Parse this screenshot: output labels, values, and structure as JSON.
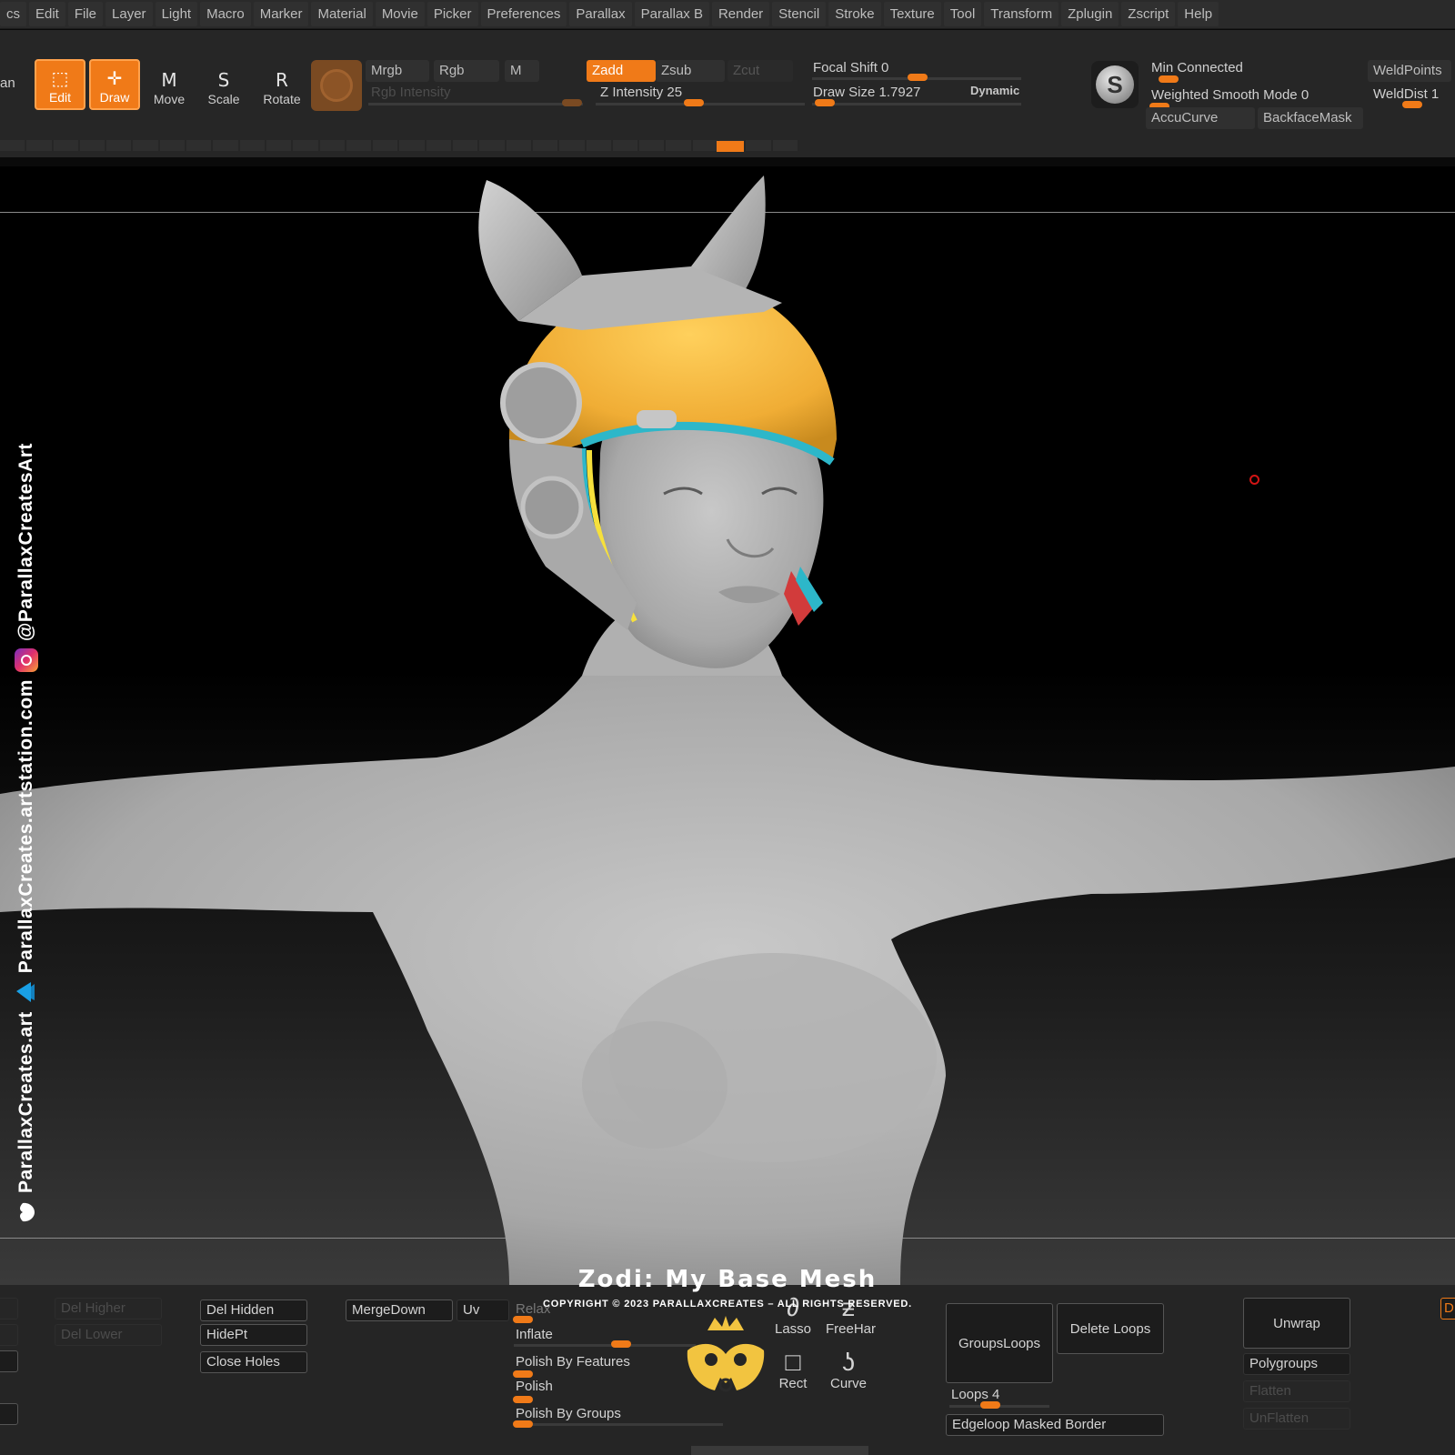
{
  "menu": [
    "cs",
    "Edit",
    "File",
    "Layer",
    "Light",
    "Macro",
    "Marker",
    "Material",
    "Movie",
    "Picker",
    "Preferences",
    "Parallax",
    "Parallax B",
    "Render",
    "Stencil",
    "Stroke",
    "Texture",
    "Tool",
    "Transform",
    "Zplugin",
    "Zscript",
    "Help"
  ],
  "shelf": {
    "left_cut": "an",
    "tools": {
      "edit": "Edit",
      "draw": "Draw",
      "move": "Move",
      "scale": "Scale",
      "rotate": "Rotate"
    },
    "tool_glyphs": {
      "move": "M",
      "scale": "S",
      "rotate": "R"
    },
    "mrgb": "Mrgb",
    "rgb": "Rgb",
    "m": "M",
    "rgb_intensity": "Rgb Intensity",
    "zadd": "Zadd",
    "zsub": "Zsub",
    "zcut": "Zcut",
    "z_intensity": "Z Intensity 25",
    "focal_shift": "Focal Shift 0",
    "draw_size": "Draw Size 1.7927",
    "dynamic": "Dynamic",
    "min_connected": "Min Connected",
    "weighted_smooth": "Weighted Smooth Mode 0",
    "accucurve": "AccuCurve",
    "backfacemask": "BackfaceMask",
    "weldpoints": "WeldPoints",
    "welddist": "WeldDist 1",
    "zremesher_glyph": "S"
  },
  "overlay": {
    "watermark_site": "ParallaxCreates.art",
    "watermark_artstation": "ParallaxCreates.artstation.com",
    "watermark_instagram": "@ParallaxCreatesArt",
    "title": "Zodi: My Base Mesh",
    "copyright": "COPYRIGHT © 2023 PARALLAXCREATES – ALL RIGHTS RESERVED."
  },
  "bottom": {
    "del_higher": "Del Higher",
    "del_lower": "Del Lower",
    "del_hidden": "Del Hidden",
    "hidept": "HidePt",
    "close_holes": "Close Holes",
    "mergedown": "MergeDown",
    "uv": "Uv",
    "relax": "Relax",
    "inflate": "Inflate",
    "polish_by_features": "Polish By Features",
    "polish": "Polish",
    "polish_by_groups": "Polish By Groups",
    "lasso": "Lasso",
    "freehand": "FreeHar",
    "rect": "Rect",
    "curve": "Curve",
    "groupsloops": "GroupsLoops",
    "delete_loops": "Delete Loops",
    "loops": "Loops 4",
    "edgeloop_masked_border": "Edgeloop Masked Border",
    "unwrap": "Unwrap",
    "polygroups": "Polygroups",
    "flatten": "Flatten",
    "unflatten": "UnFlatten",
    "right_cut": "D"
  },
  "colors": {
    "accent": "#f07a18",
    "helmet": "#f2b13a",
    "skin": "#b9b9b9"
  }
}
